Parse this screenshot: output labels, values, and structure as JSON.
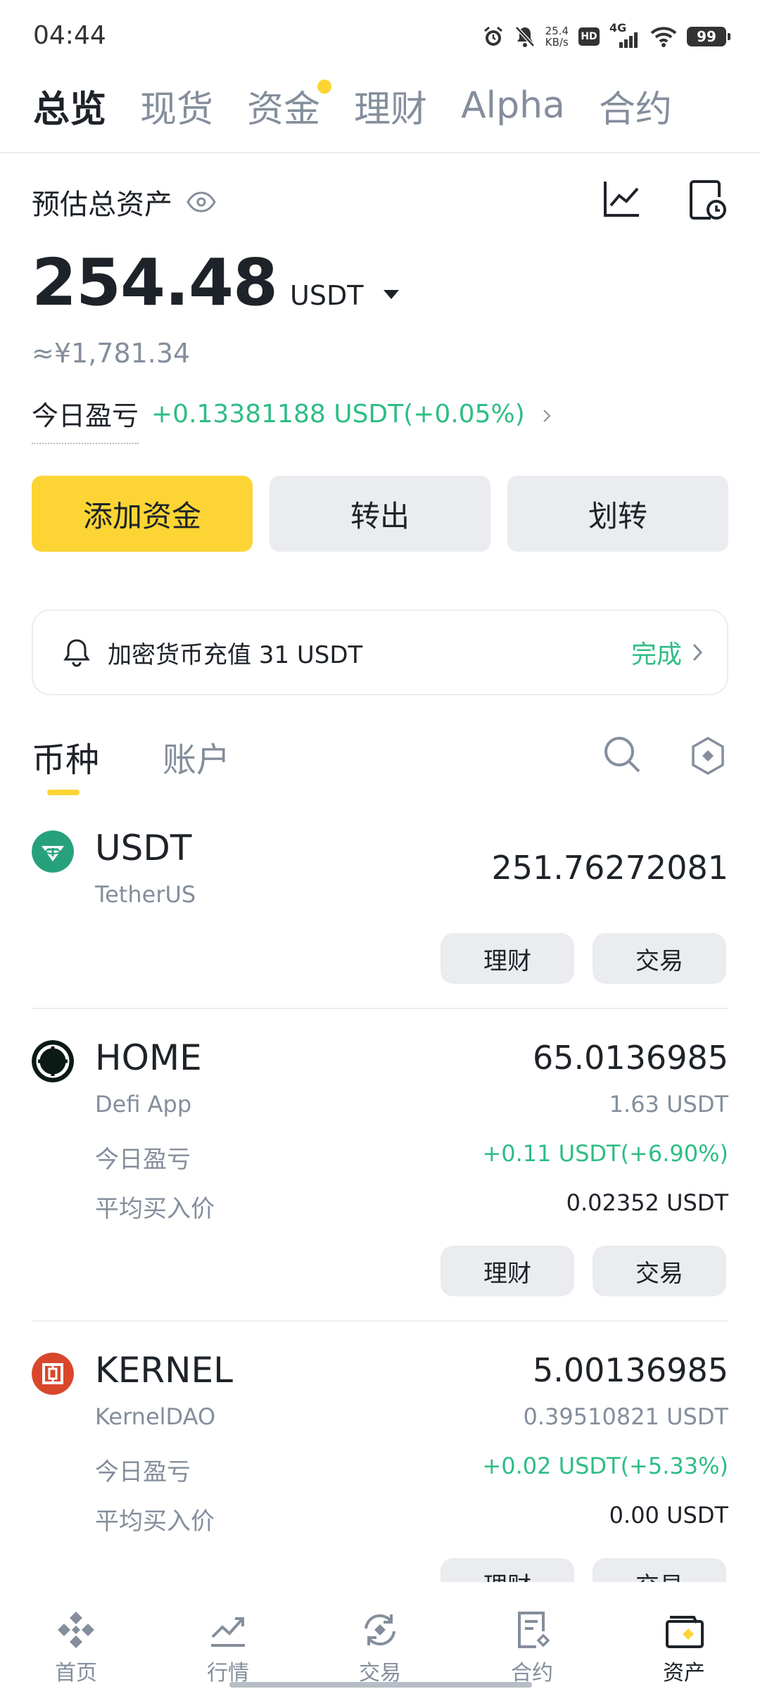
{
  "status_bar": {
    "time": "04:44",
    "net_speed_value": "25.4",
    "net_speed_unit": "KB/s",
    "hd": "HD",
    "network": "4G",
    "battery": "99"
  },
  "top_tabs": [
    {
      "label": "总览",
      "active": true
    },
    {
      "label": "现货"
    },
    {
      "label": "资金",
      "has_dot": true
    },
    {
      "label": "理财"
    },
    {
      "label": "Alpha"
    },
    {
      "label": "合约"
    }
  ],
  "overview": {
    "estimated_label": "预估总资产",
    "total_value": "254.48",
    "unit": "USDT",
    "cny_value": "≈¥1,781.34",
    "pnl_label": "今日盈亏",
    "pnl_value": "+0.13381188 USDT(+0.05%)"
  },
  "actions": {
    "add_funds": "添加资金",
    "withdraw": "转出",
    "transfer": "划转"
  },
  "notice": {
    "text": "加密货币充值 31 USDT",
    "action": "完成"
  },
  "sub_tabs": {
    "coins": "币种",
    "accounts": "账户"
  },
  "coins": [
    {
      "symbol": "USDT",
      "name": "TetherUS",
      "amount": "251.76272081",
      "icon": "tether-icon",
      "color": "#26a17b",
      "earn": "理财",
      "trade": "交易"
    },
    {
      "symbol": "HOME",
      "name": "Defi App",
      "amount": "65.0136985",
      "value": "1.63 USDT",
      "pnl_label": "今日盈亏",
      "pnl": "+0.11 USDT(+6.90%)",
      "avg_label": "平均买入价",
      "avg_price": "0.02352 USDT",
      "icon": "defi-app-icon",
      "color": "#0b1a14",
      "earn": "理财",
      "trade": "交易"
    },
    {
      "symbol": "KERNEL",
      "name": "KernelDAO",
      "amount": "5.00136985",
      "value": "0.39510821 USDT",
      "pnl_label": "今日盈亏",
      "pnl": "+0.02 USDT(+5.33%)",
      "avg_label": "平均买入价",
      "avg_price": "0.00 USDT",
      "icon": "kerneldao-icon",
      "color": "#d9472b",
      "earn": "理财",
      "trade": "交易"
    }
  ],
  "bottom_nav": [
    {
      "label": "首页",
      "icon": "home-icon"
    },
    {
      "label": "行情",
      "icon": "markets-icon"
    },
    {
      "label": "交易",
      "icon": "trade-icon"
    },
    {
      "label": "合约",
      "icon": "futures-icon"
    },
    {
      "label": "资产",
      "icon": "wallet-icon",
      "active": true
    }
  ],
  "colors": {
    "accent": "#fcd535",
    "positive": "#2ebd85",
    "muted": "#848e9c",
    "text": "#1e2329",
    "button_bg": "#eaecef"
  }
}
